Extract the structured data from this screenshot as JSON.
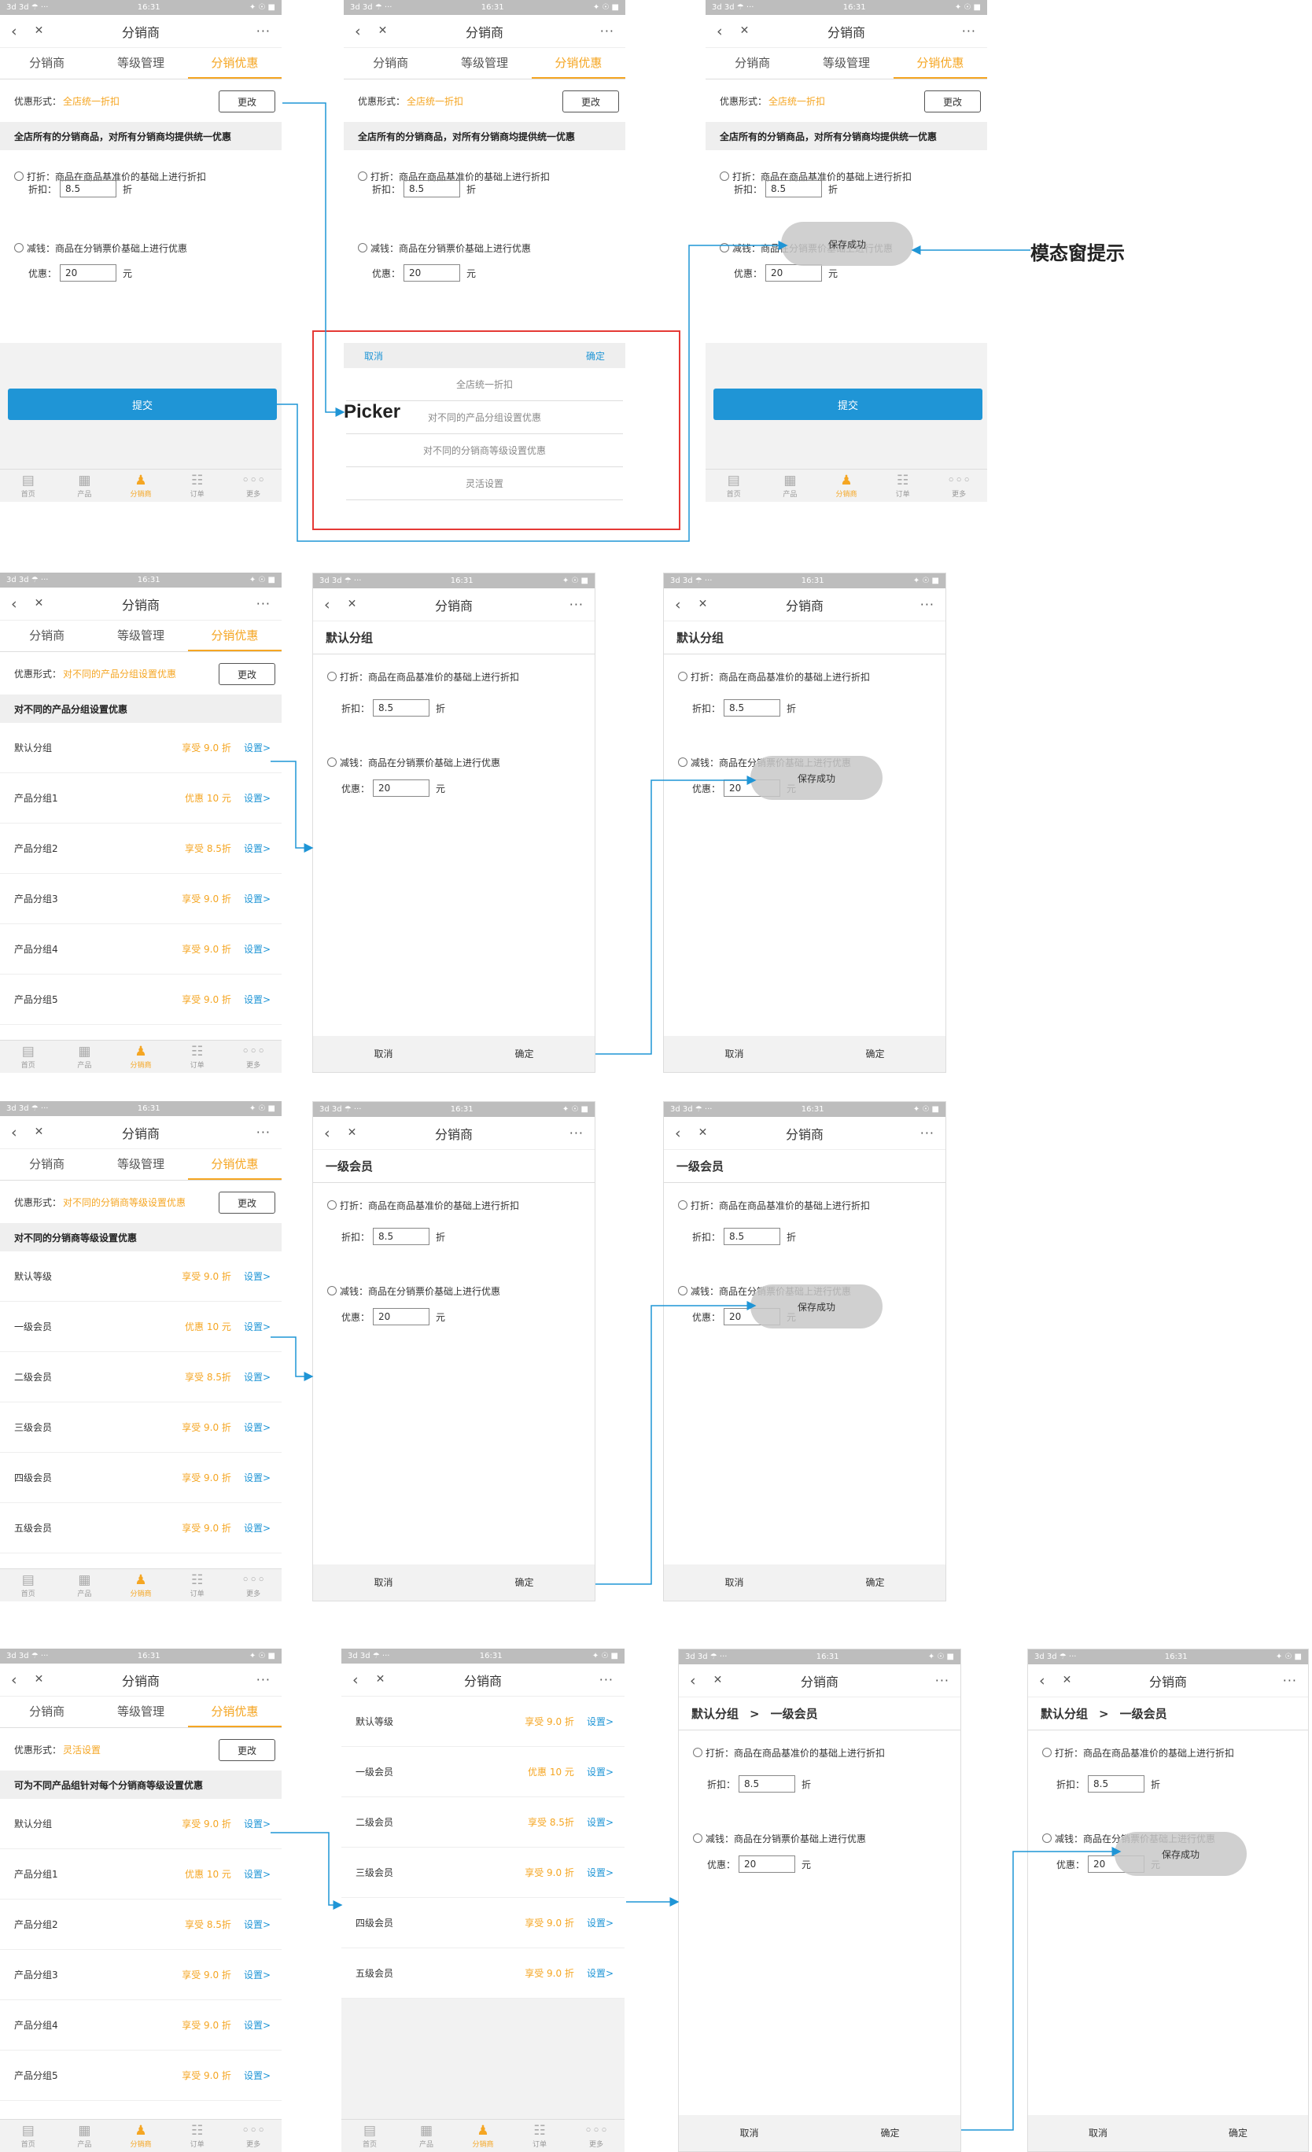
{
  "common": {
    "status_left": "3d 3d ☂ ···",
    "status_time": "16:31",
    "status_right": "✦ ☉ ■",
    "back_glyph": "‹",
    "close_glyph": "✕",
    "title": "分销商",
    "more": "···",
    "tabs": [
      "分销商",
      "等级管理",
      "分销优惠"
    ],
    "change": "更改",
    "form_label": "优惠形式：",
    "opt_discount": "打折：商品在商品基准价的基础上进行折扣",
    "opt_minus": "减钱：商品在分销票价基础上进行优惠",
    "lbl_discount": "折扣：",
    "lbl_minus": "优惠：",
    "val_discount": "8.5",
    "val_minus": "20",
    "unit_discount": "折",
    "unit_minus": "元",
    "submit": "提交",
    "cancel": "取消",
    "confirm": "确定",
    "toast": "保存成功",
    "setting": "设置>",
    "tabbar": [
      {
        "label": "首页",
        "icon": "home-icon",
        "glyph": "▤"
      },
      {
        "label": "产品",
        "icon": "product-icon",
        "glyph": "▦"
      },
      {
        "label": "分销商",
        "icon": "distributor-icon",
        "glyph": "♟"
      },
      {
        "label": "订单",
        "icon": "order-icon",
        "glyph": "☷"
      },
      {
        "label": "更多",
        "icon": "more-icon",
        "glyph": "◦◦◦"
      }
    ]
  },
  "row1": {
    "form_value": "全店统一折扣",
    "section": "全店所有的分销商品，对所有分销商均提供统一优惠"
  },
  "picker": {
    "cancel": "取消",
    "confirm": "确定",
    "items": [
      "全店统一折扣",
      "对不同的产品分组设置优惠",
      "对不同的分销商等级设置优惠",
      "灵活设置"
    ],
    "caption": "Picker"
  },
  "modal_caption": "模态窗提示",
  "row2": {
    "form_value": "对不同的产品分组设置优惠",
    "section": "对不同的产品分组设置优惠",
    "header": "默认分组",
    "items": [
      {
        "name": "默认分组",
        "price": "享受 9.0 折"
      },
      {
        "name": "产品分组1",
        "price": "优惠 10 元"
      },
      {
        "name": "产品分组2",
        "price": "享受 8.5折"
      },
      {
        "name": "产品分组3",
        "price": "享受 9.0 折"
      },
      {
        "name": "产品分组4",
        "price": "享受 9.0 折"
      },
      {
        "name": "产品分组5",
        "price": "享受 9.0 折"
      }
    ]
  },
  "row3": {
    "form_value": "对不同的分销商等级设置优惠",
    "section": "对不同的分销商等级设置优惠",
    "header": "一级会员",
    "items": [
      {
        "name": "默认等级",
        "price": "享受 9.0 折"
      },
      {
        "name": "一级会员",
        "price": "优惠 10 元"
      },
      {
        "name": "二级会员",
        "price": "享受 8.5折"
      },
      {
        "name": "三级会员",
        "price": "享受 9.0 折"
      },
      {
        "name": "四级会员",
        "price": "享受 9.0 折"
      },
      {
        "name": "五级会员",
        "price": "享受 9.0 折"
      }
    ]
  },
  "row4": {
    "form_value": "灵活设置",
    "section": "可为不同产品组针对每个分销商等级设置优惠",
    "header_a": "默认分组",
    "header_sep": ">",
    "header_b": "一级会员",
    "items": [
      {
        "name": "默认分组",
        "price": "享受 9.0 折"
      },
      {
        "name": "产品分组1",
        "price": "优惠 10 元"
      },
      {
        "name": "产品分组2",
        "price": "享受 8.5折"
      },
      {
        "name": "产品分组3",
        "price": "享受 9.0 折"
      },
      {
        "name": "产品分组4",
        "price": "享受 9.0 折"
      },
      {
        "name": "产品分组5",
        "price": "享受 9.0 折"
      }
    ],
    "levels": [
      {
        "name": "默认等级",
        "price": "享受 9.0 折"
      },
      {
        "name": "一级会员",
        "price": "优惠 10 元"
      },
      {
        "name": "二级会员",
        "price": "享受 8.5折"
      },
      {
        "name": "三级会员",
        "price": "享受 9.0 折"
      },
      {
        "name": "四级会员",
        "price": "享受 9.0 折"
      },
      {
        "name": "五级会员",
        "price": "享受 9.0 折"
      }
    ]
  },
  "colors": {
    "accent": "#f5a623",
    "link": "#1f95d6",
    "flow": "#1f95d6",
    "highlight": "#e53935"
  }
}
